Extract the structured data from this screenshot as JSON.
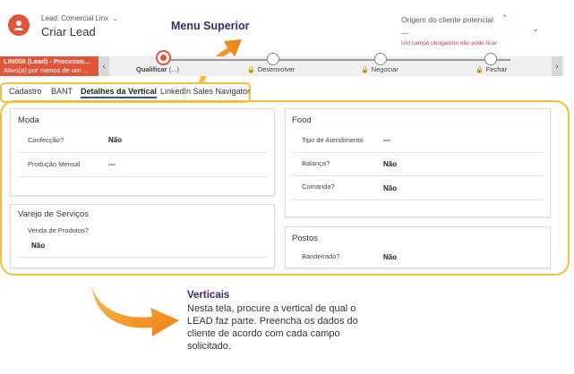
{
  "header": {
    "entity": "Lead: Comercial Linx",
    "title": "Criar Lead",
    "origin_label": "Origem do cliente potencial",
    "origin_required": "*",
    "origin_value": "---",
    "origin_error": "Um campo obrigatório não pode ficar"
  },
  "process": {
    "name": "LIN008 (Lead) - Processo...",
    "status": "Ativo(a) por menos de um ...",
    "stages": [
      {
        "label": "Qualificar",
        "extra": "(...)",
        "active": true
      },
      {
        "label": "Desenvolver",
        "locked": true
      },
      {
        "label": "Negociar",
        "locked": true
      },
      {
        "label": "Fechar",
        "locked": true
      }
    ]
  },
  "tabs": [
    "Cadastro",
    "BANT",
    "Detalhes da Vertical",
    "LinkedIn Sales Navigator"
  ],
  "sections": {
    "moda": {
      "title": "Moda",
      "fields": [
        {
          "label": "Confecção?",
          "value": "Não"
        },
        {
          "label": "Produção Mensal",
          "value": "---"
        }
      ]
    },
    "food": {
      "title": "Food",
      "fields": [
        {
          "label": "Tipo de Atendimento",
          "value": "---"
        },
        {
          "label": "Balança?",
          "value": "Não"
        },
        {
          "label": "Comanda?",
          "value": "Não"
        }
      ]
    },
    "varejo": {
      "title": "Varejo de Serviços",
      "fields": [
        {
          "label": "Venda de Produtos?",
          "value": "Não"
        }
      ]
    },
    "postos": {
      "title": "Postos",
      "fields": [
        {
          "label": "Bandeirado?",
          "value": "Não"
        }
      ]
    }
  },
  "annotations": {
    "menu_superior": "Menu Superior",
    "verticais_title": "Verticais",
    "verticais_text": "Nesta tela, procure a vertical de qual o LEAD faz parte. Preencha os dados do cliente de acordo com cada campo solicitado."
  },
  "colors": {
    "accent": "#e2553b",
    "highlight": "#f0c23b",
    "arrow": "#f39a1d",
    "annotation_title": "#3d2a6b"
  }
}
